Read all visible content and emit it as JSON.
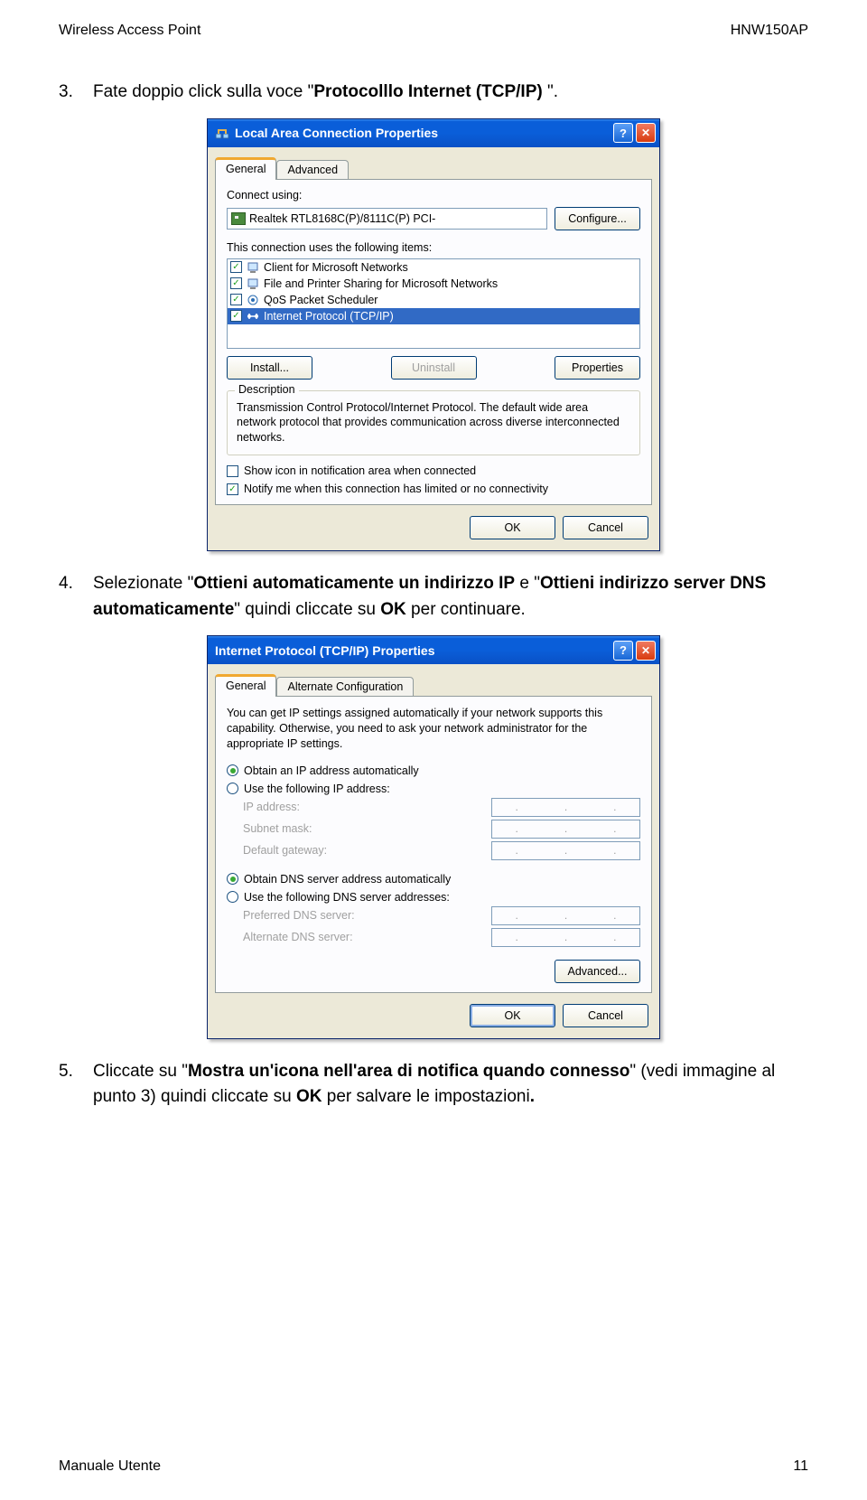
{
  "header": {
    "left": "Wireless Access Point",
    "right": "HNW150AP"
  },
  "footer": {
    "left": "Manuale Utente",
    "right": "11"
  },
  "steps": {
    "s3": {
      "num": "3.",
      "pre": "Fate doppio click sulla voce \"",
      "b": "Protocolllo Internet (TCP/IP)",
      "post": " \"."
    },
    "s4": {
      "num": "4.",
      "t1": "Selezionate \"",
      "b1": "Ottieni automaticamente un indirizzo IP",
      "t2": " e \"",
      "b2": "Ottieni indirizzo server DNS automaticamente",
      "t3": "\" quindi cliccate su ",
      "b3": "OK",
      "t4": " per continuare."
    },
    "s5": {
      "num": "5.",
      "t1": "Cliccate su \"",
      "b1": "Mostra un'icona nell'area di notifica quando connesso",
      "t2": "\" (vedi immagine al punto 3) quindi cliccate su ",
      "b2": "OK",
      "t3": " per salvare le impostazioni",
      "b3": "."
    }
  },
  "dlg1": {
    "title": "Local Area Connection Properties",
    "tabs": {
      "general": "General",
      "advanced": "Advanced"
    },
    "connectUsing": "Connect using:",
    "adapter": "Realtek RTL8168C(P)/8111C(P) PCI-",
    "configure": "Configure...",
    "itemsLabel": "This connection uses the following items:",
    "items": [
      "Client for Microsoft Networks",
      "File and Printer Sharing for Microsoft Networks",
      "QoS Packet Scheduler",
      "Internet Protocol (TCP/IP)"
    ],
    "install": "Install...",
    "uninstall": "Uninstall",
    "properties": "Properties",
    "descLabel": "Description",
    "desc": "Transmission Control Protocol/Internet Protocol. The default wide area network protocol that provides communication across diverse interconnected networks.",
    "showIcon": "Show icon in notification area when connected",
    "notifyLimited": "Notify me when this connection has limited or no connectivity",
    "ok": "OK",
    "cancel": "Cancel"
  },
  "dlg2": {
    "title": "Internet Protocol (TCP/IP) Properties",
    "tabs": {
      "general": "General",
      "alt": "Alternate Configuration"
    },
    "intro": "You can get IP settings assigned automatically if your network supports this capability. Otherwise, you need to ask your network administrator for the appropriate IP settings.",
    "r1": "Obtain an IP address automatically",
    "r2": "Use the following IP address:",
    "ip": "IP address:",
    "subnet": "Subnet mask:",
    "gateway": "Default gateway:",
    "r3": "Obtain DNS server address automatically",
    "r4": "Use the following DNS server addresses:",
    "pref": "Preferred DNS server:",
    "alt": "Alternate DNS server:",
    "advanced": "Advanced...",
    "ok": "OK",
    "cancel": "Cancel"
  }
}
